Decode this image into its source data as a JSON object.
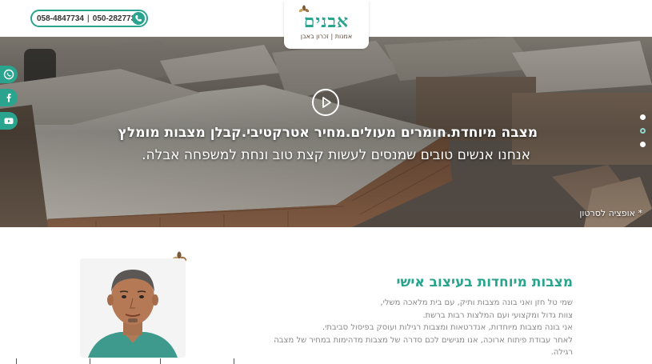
{
  "header": {
    "phones": [
      "058-4847734",
      "050-2827733"
    ],
    "separator": "|",
    "logo_text": "אבנים",
    "logo_subtitle": "אמנות | זכרון באבן"
  },
  "hero": {
    "title": "מצבה מיוחדת.חומרים מעולים.מחיר אטרקטיבי.קבלן מצבות מומלץ",
    "subtitle": "אנחנו אנשים טובים שמנסים לעשות קצת טוב ונחת למשפחה אבלה.",
    "caption": "* אופציה לסרטון",
    "slides_count": 3,
    "active_slide": 2
  },
  "social": [
    "whatsapp-icon",
    "facebook-icon",
    "youtube-icon"
  ],
  "about": {
    "title": "מצבות מיוחדות בעיצוב אישי",
    "lines": [
      "שמי טל חזן ואני בונה מצבות ותיק, עם בית מלאכה משלי,",
      "צוות גדול ומקצועי ועם המלצות רבות ברשת.",
      "אני בונה מצבות מיוחדות, אנדרטאות ומצבות רגילות ועוסק בפיסול סביבתי.",
      "לאחר עבודת פיתוח ארוכה, אנו מגישים לכם סדרה של מצבות מדהימות במחיר של מצבה",
      "רגילה."
    ]
  },
  "colors": {
    "brand": "#2aa48e",
    "text_muted": "#888888",
    "logo_brown": "#5a4a3a"
  }
}
